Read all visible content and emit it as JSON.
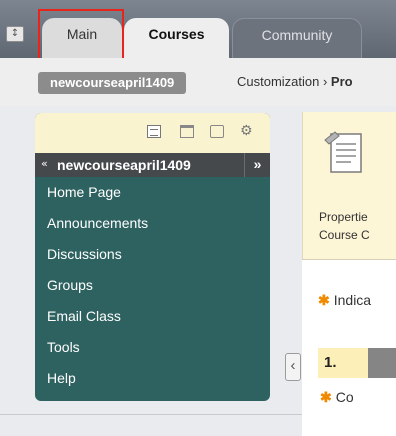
{
  "tabs": [
    {
      "label": "Main"
    },
    {
      "label": "Courses"
    },
    {
      "label": "Community"
    }
  ],
  "toggle_icon": "↕",
  "breadcrumb": {
    "course_id": "newcourseapril1409",
    "path_prefix": "Customization › ",
    "path_current": "Pro"
  },
  "course_menu": {
    "header_arrow": "«",
    "title": "newcourseapril1409",
    "collapse": "»",
    "gear": "⚙",
    "items": [
      {
        "label": "Home Page"
      },
      {
        "label": "Announcements"
      },
      {
        "label": "Discussions"
      },
      {
        "label": "Groups"
      },
      {
        "label": "Email Class"
      },
      {
        "label": "Tools"
      },
      {
        "label": "Help"
      }
    ]
  },
  "side_handle": "‹",
  "content": {
    "top_line1": "Propertie",
    "top_line2": "Course C",
    "required_star": "✱",
    "required_note": "Indica",
    "step_number": "1.",
    "step_star": "✱",
    "step_text": "Co"
  },
  "colors": {
    "highlight": "#e8241b",
    "menu_bg": "#2e6260",
    "star": "#f08a00"
  },
  "icons": [
    "up-down-arrows-icon",
    "list-view-icon",
    "folder-icon",
    "window-icon",
    "gear-icon",
    "document-icon"
  ]
}
